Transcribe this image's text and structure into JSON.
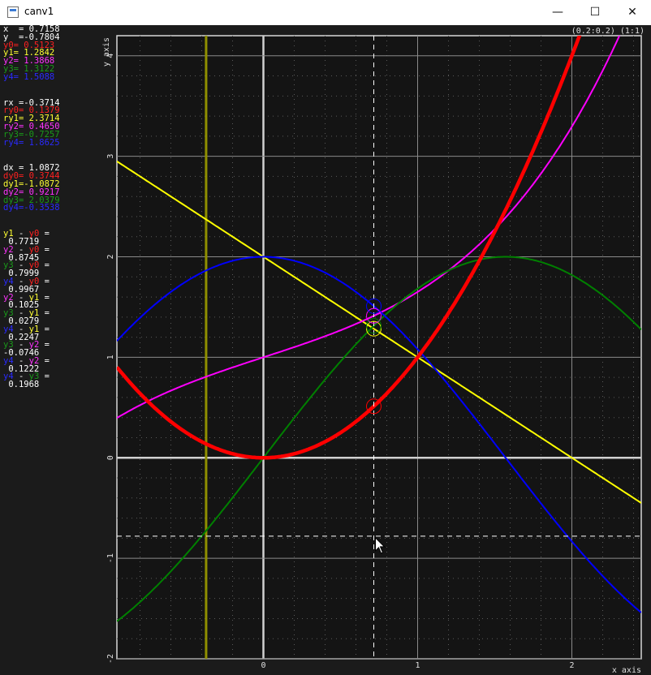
{
  "window": {
    "title": "canv1"
  },
  "titlebar": {
    "minimize": "—",
    "maximize": "☐",
    "close": "✕"
  },
  "plot": {
    "scale_label": "(0.2:0.2) (1:1)",
    "x_axis_label": "x axis",
    "y_axis_label": "y axis",
    "x_ticks": [
      "0",
      "1",
      "2"
    ],
    "y_ticks": [
      "-2",
      "-1",
      "0",
      "1",
      "2",
      "3",
      "4"
    ],
    "xlim": [
      -0.95,
      2.45
    ],
    "ylim": [
      -2.0,
      4.2
    ],
    "cursor": {
      "x": 0.7158,
      "y": -0.7804
    },
    "vertical_marker_x": -0.3714
  },
  "readout": {
    "cursor": [
      {
        "text": "x  = 0.7158",
        "color": "#ffffff"
      },
      {
        "text": "y  =-0.7804",
        "color": "#ffffff"
      },
      {
        "text": "y0= 0.5123",
        "color": "#ff2020"
      },
      {
        "text": "y1= 1.2842",
        "color": "#ffff33"
      },
      {
        "text": "y2= 1.3868",
        "color": "#ff33ff"
      },
      {
        "text": "y3= 1.3122",
        "color": "#1a9a1a"
      },
      {
        "text": "y4= 1.5088",
        "color": "#2a2aff"
      }
    ],
    "reference": [
      {
        "text": "rx =-0.3714",
        "color": "#ffffff"
      },
      {
        "text": "ry0= 0.1379",
        "color": "#ff2020"
      },
      {
        "text": "ry1= 2.3714",
        "color": "#ffff33"
      },
      {
        "text": "ry2= 0.4650",
        "color": "#ff33ff"
      },
      {
        "text": "ry3=-0.7257",
        "color": "#1a9a1a"
      },
      {
        "text": "ry4= 1.8625",
        "color": "#2a2aff"
      }
    ],
    "deltas": [
      {
        "text": "dx = 1.0872",
        "color": "#ffffff"
      },
      {
        "text": "dy0= 0.3744",
        "color": "#ff2020"
      },
      {
        "text": "dy1=-1.0872",
        "color": "#ffff33"
      },
      {
        "text": "dy2= 0.9217",
        "color": "#ff33ff"
      },
      {
        "text": "dy3= 2.0379",
        "color": "#1a9a1a"
      },
      {
        "text": "dy4=-0.3538",
        "color": "#2a2aff"
      }
    ],
    "differences": [
      {
        "a": "y1",
        "ac": "#ffff33",
        "b": "y0",
        "bc": "#ff2020",
        "value": " 0.7719"
      },
      {
        "a": "y2",
        "ac": "#ff33ff",
        "b": "y0",
        "bc": "#ff2020",
        "value": " 0.8745"
      },
      {
        "a": "y3",
        "ac": "#1a9a1a",
        "b": "y0",
        "bc": "#ff2020",
        "value": " 0.7999"
      },
      {
        "a": "y4",
        "ac": "#2a2aff",
        "b": "y0",
        "bc": "#ff2020",
        "value": " 0.9967"
      },
      {
        "a": "y2",
        "ac": "#ff33ff",
        "b": "y1",
        "bc": "#ffff33",
        "value": " 0.1025"
      },
      {
        "a": "y3",
        "ac": "#1a9a1a",
        "b": "y1",
        "bc": "#ffff33",
        "value": " 0.0279"
      },
      {
        "a": "y4",
        "ac": "#2a2aff",
        "b": "y1",
        "bc": "#ffff33",
        "value": " 0.2247"
      },
      {
        "a": "y3",
        "ac": "#1a9a1a",
        "b": "y2",
        "bc": "#ff33ff",
        "value": "-0.0746"
      },
      {
        "a": "y4",
        "ac": "#2a2aff",
        "b": "y2",
        "bc": "#ff33ff",
        "value": " 0.1222"
      },
      {
        "a": "y4",
        "ac": "#2a2aff",
        "b": "y3",
        "bc": "#1a9a1a",
        "value": " 0.1968"
      }
    ]
  },
  "chart_data": {
    "type": "line",
    "xlim": [
      -0.95,
      2.45
    ],
    "ylim": [
      -2.0,
      4.2
    ],
    "grid": true,
    "series": [
      {
        "color": "#ff0000",
        "expr": "x^2"
      },
      {
        "color": "#ffff00",
        "expr": "2 - x"
      },
      {
        "color": "#ff00ff",
        "expr": "1 + 0.5*sin(x) + 0.23*x^3"
      },
      {
        "color": "#008000",
        "expr": "2*sin(x)"
      },
      {
        "color": "#0000ff",
        "expr": "2*cos(x)"
      }
    ]
  }
}
